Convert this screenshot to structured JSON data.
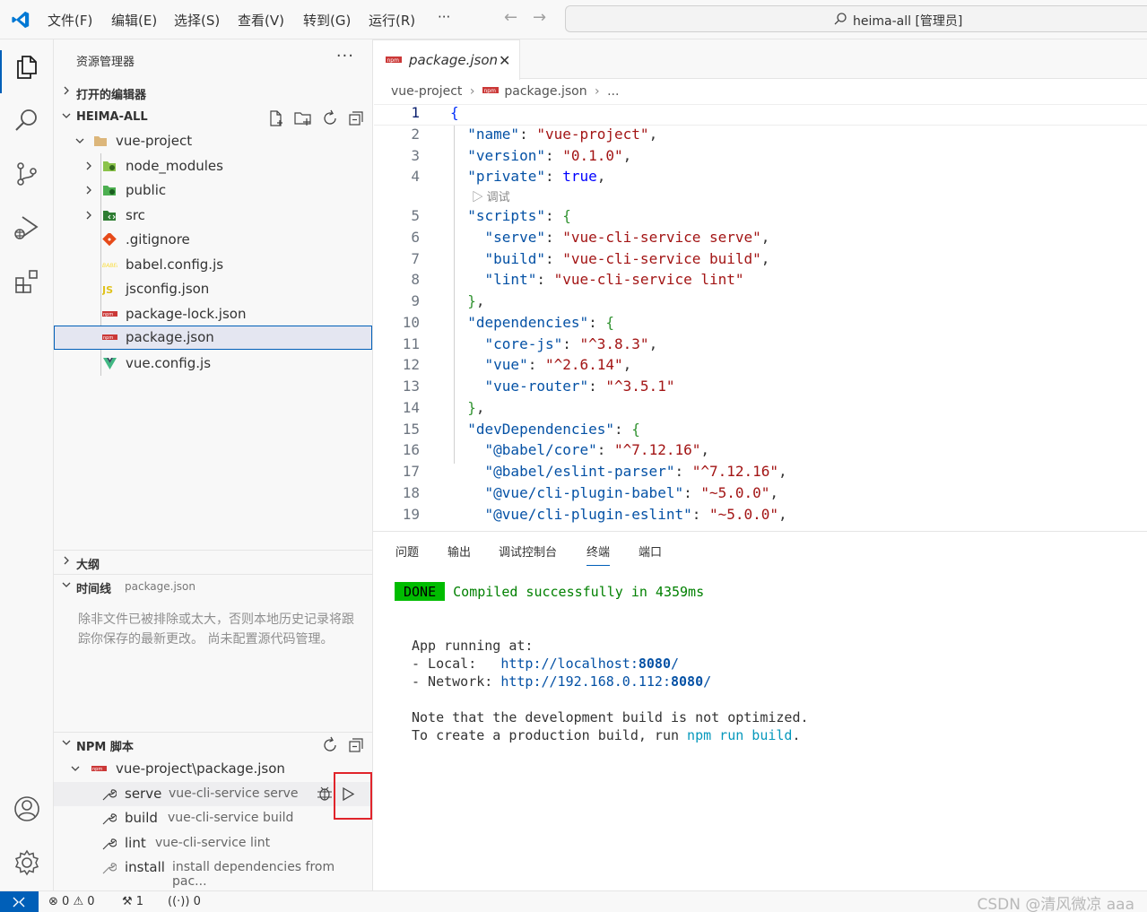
{
  "titlebar": {
    "menus": [
      "文件(F)",
      "编辑(E)",
      "选择(S)",
      "查看(V)",
      "转到(G)",
      "运行(R)",
      "···"
    ],
    "search_text": "heima-all [管理员]"
  },
  "sidebar": {
    "title": "资源管理器",
    "more": "···",
    "open_editors": "打开的编辑器",
    "workspace": "HEIMA-ALL",
    "tree": [
      {
        "label": "vue-project"
      },
      {
        "label": "node_modules"
      },
      {
        "label": "public"
      },
      {
        "label": "src"
      },
      {
        "label": ".gitignore"
      },
      {
        "label": "babel.config.js"
      },
      {
        "label": "jsconfig.json"
      },
      {
        "label": "package-lock.json"
      },
      {
        "label": "package.json"
      },
      {
        "label": "vue.config.js"
      }
    ],
    "outline": "大纲",
    "timeline": "时间线",
    "timeline_file": "package.json",
    "timeline_msg": "除非文件已被排除或太大，否则本地历史记录将跟踪你保存的最新更改。 尚未配置源代码管理。",
    "npm_title": "NPM 脚本",
    "npm_root": "vue-project\\package.json",
    "npm_scripts": [
      {
        "name": "serve",
        "cmd": "vue-cli-service serve"
      },
      {
        "name": "build",
        "cmd": "vue-cli-service build"
      },
      {
        "name": "lint",
        "cmd": "vue-cli-service lint"
      },
      {
        "name": "install",
        "cmd": "install dependencies from pac..."
      }
    ]
  },
  "editor": {
    "tab_label": "package.json",
    "breadcrumb": [
      "vue-project",
      "package.json",
      "..."
    ],
    "codelens": "调试",
    "lines": [
      {
        "n": "1"
      },
      {
        "n": "2"
      },
      {
        "n": "3"
      },
      {
        "n": "4"
      },
      {
        "n": "5"
      },
      {
        "n": "6"
      },
      {
        "n": "7"
      },
      {
        "n": "8"
      },
      {
        "n": "9"
      },
      {
        "n": "10"
      },
      {
        "n": "11"
      },
      {
        "n": "12"
      },
      {
        "n": "13"
      },
      {
        "n": "14"
      },
      {
        "n": "15"
      },
      {
        "n": "16"
      },
      {
        "n": "17"
      },
      {
        "n": "18"
      },
      {
        "n": "19"
      }
    ]
  },
  "panel": {
    "tabs": [
      "问题",
      "输出",
      "调试控制台",
      "终端",
      "端口"
    ],
    "active_tab": "终端",
    "done": "DONE",
    "compiled": "Compiled successfully in 4359ms",
    "app_running": "App running at:",
    "local_label": "- Local:   ",
    "local_url": "http://localhost:",
    "local_port": "8080",
    "local_slash": "/",
    "network_label": "- Network: ",
    "network_url": "http://192.168.0.112:",
    "network_port": "8080",
    "network_slash": "/",
    "note1": "Note that the development build is not optimized.",
    "note2_a": "To create a production build, run ",
    "note2_b": "npm run build",
    "note2_c": "."
  },
  "statusbar": {
    "errors": "0",
    "warnings": "0",
    "tools": "1",
    "ports": "0"
  },
  "watermark": "CSDN @清风微凉 aaa",
  "colors": {
    "accent": "#005fb8",
    "done_bg": "#00bc00",
    "highlight_box": "#e0242b"
  }
}
